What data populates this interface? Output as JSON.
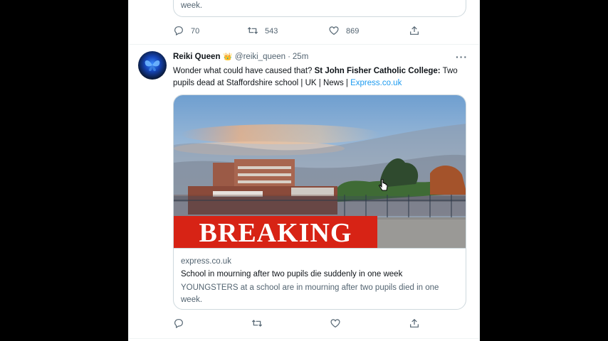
{
  "prev_tweet": {
    "card_snippet": "week.",
    "reply_count": "70",
    "retweet_count": "543",
    "like_count": "869"
  },
  "tweet": {
    "display_name": "Reiki Queen",
    "badge_emoji": "👑",
    "handle": "@reiki_queen",
    "dot": "·",
    "time": "25m",
    "more": "···",
    "text_plain": "Wonder what could have caused that? ",
    "text_bold": "St John Fisher Catholic College:",
    "text_rest": " Two pupils dead at Staffordshire school | UK | News | ",
    "text_link": "Express.co.uk",
    "card": {
      "image_banner": "BREAKING",
      "domain": "express.co.uk",
      "title": "School in mourning after two pupils die suddenly in one week",
      "description": "YOUNGSTERS at a school are in mourning after two pupils died in one week."
    }
  },
  "icons": {
    "reply": "reply-icon",
    "retweet": "retweet-icon",
    "like": "heart-icon",
    "share": "share-icon",
    "more": "more-icon",
    "cursor": "cursor-icon"
  },
  "colors": {
    "link": "#1d9bf0",
    "text": "#0f1419",
    "muted": "#536471",
    "banner_red": "#d72315"
  }
}
